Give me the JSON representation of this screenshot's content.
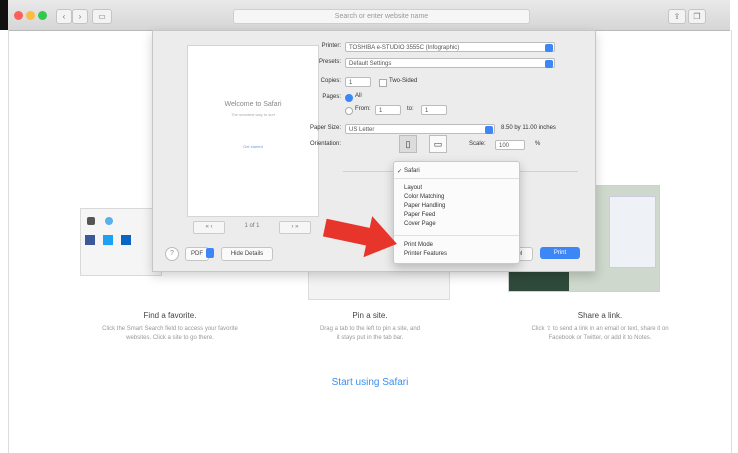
{
  "browser": {
    "address_placeholder": "Search or enter website name"
  },
  "background": {
    "columns": [
      {
        "title": "Find a favorite.",
        "desc1": "Click the Smart Search field to access your favorite",
        "desc2": "websites. Click a site to go there."
      },
      {
        "title": "Pin a site.",
        "desc1": "Drag a tab to the left to pin a site, and",
        "desc2": "it stays put in the tab bar."
      },
      {
        "title": "Share a link.",
        "desc1": "Click ⇪ to send a link in an email or text, share it on",
        "desc2": "Facebook or Twitter, or add it to Notes."
      }
    ],
    "start_link": "Start using Safari"
  },
  "print": {
    "preview": {
      "title": "Welcome to Safari",
      "subtitle": "The smartest way to surf",
      "link": "Get started",
      "page_label": "1 of 1"
    },
    "labels": {
      "printer": "Printer:",
      "presets": "Presets:",
      "copies": "Copies:",
      "pages": "Pages:",
      "paper_size": "Paper Size:",
      "orientation": "Orientation:",
      "scale": "Scale:"
    },
    "values": {
      "printer": "TOSHIBA e-STUDIO 3555C (Infographic)",
      "presets": "Default Settings",
      "copies": "1",
      "two_sided": "Two-Sided",
      "pages_all": "All",
      "pages_from": "From:",
      "pages_from_value": "1",
      "pages_to": "to:",
      "pages_to_value": "1",
      "paper_size": "US Letter",
      "paper_dims": "8.50 by 11.00 inches",
      "scale": "100",
      "scale_unit": "%"
    },
    "bottom": {
      "help": "?",
      "pdf": "PDF",
      "hide_details": "Hide Details",
      "cancel": "Cancel",
      "print": "Print"
    }
  },
  "menu": {
    "checked": "Safari",
    "items": [
      "Layout",
      "Color Matching",
      "Paper Handling",
      "Paper Feed",
      "Cover Page"
    ],
    "items2": [
      "Print Mode",
      "Printer Features"
    ]
  },
  "colors": {
    "accent": "#3d86f5",
    "arrow": "#e8352b"
  }
}
